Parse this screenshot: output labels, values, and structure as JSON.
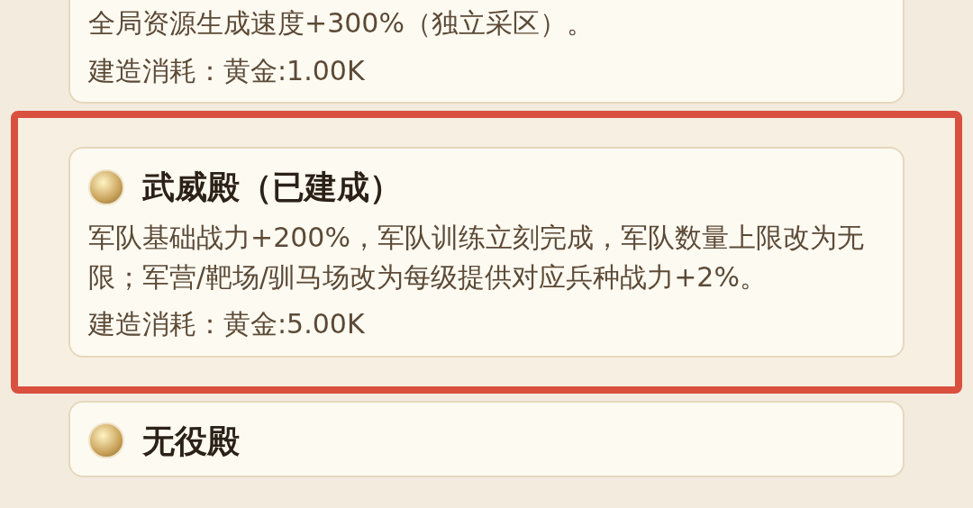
{
  "cards": [
    {
      "highlighted": false,
      "description": "全局资源生成速度+300%（独立采区）。",
      "cost": "建造消耗：黄金:1.00K"
    },
    {
      "highlighted": true,
      "title": "武威殿（已建成）",
      "description": "军队基础战力+200%，军队训练立刻完成，军队数量上限改为无限；军营/靶场/驯马场改为每级提供对应兵种战力+2%。",
      "cost": "建造消耗：黄金:5.00K"
    },
    {
      "highlighted": false,
      "title": "无役殿"
    }
  ]
}
